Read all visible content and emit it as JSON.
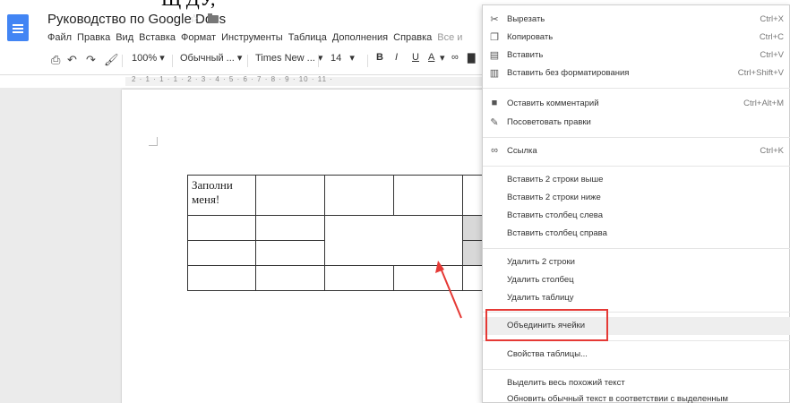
{
  "top_clip": "Щ ДУ,",
  "header": {
    "title": "Руководство по Google Docs",
    "menu": [
      "Файл",
      "Правка",
      "Вид",
      "Вставка",
      "Формат",
      "Инструменты",
      "Таблица",
      "Дополнения",
      "Справка",
      "Все и"
    ]
  },
  "toolbar": {
    "zoom": "100%",
    "style": "Обычный ...",
    "font": "Times New ...",
    "size": "14",
    "bold": "B",
    "italic": "I",
    "underline": "U",
    "textcolor": "A"
  },
  "ruler": "2 · 1 · 1 · 1 · 2 · 3 · 4 · 5 · 6 · 7 · 8 · 9 · 10 · 11 ·",
  "table": {
    "cell_text": "Заполни меня!"
  },
  "context_menu": {
    "items": [
      {
        "label": "Вырезать",
        "shortcut": "Ctrl+X",
        "icon": "scissors-icon"
      },
      {
        "label": "Копировать",
        "shortcut": "Ctrl+C",
        "icon": "copy-icon"
      },
      {
        "label": "Вставить",
        "shortcut": "Ctrl+V",
        "icon": "paste-icon"
      },
      {
        "label": "Вставить без форматирования",
        "shortcut": "Ctrl+Shift+V",
        "icon": "paste-plain-icon"
      },
      {
        "label": "Оставить комментарий",
        "shortcut": "Ctrl+Alt+M",
        "icon": "comment-icon"
      },
      {
        "label": "Посоветовать правки",
        "shortcut": "",
        "icon": "suggest-icon"
      },
      {
        "label": "Ссылка",
        "shortcut": "Ctrl+K",
        "icon": "link-icon"
      },
      {
        "label": "Вставить 2 строки выше",
        "shortcut": ""
      },
      {
        "label": "Вставить 2 строки ниже",
        "shortcut": ""
      },
      {
        "label": "Вставить столбец слева",
        "shortcut": ""
      },
      {
        "label": "Вставить столбец справа",
        "shortcut": ""
      },
      {
        "label": "Удалить 2 строки",
        "shortcut": ""
      },
      {
        "label": "Удалить столбец",
        "shortcut": ""
      },
      {
        "label": "Удалить таблицу",
        "shortcut": ""
      },
      {
        "label": "Объединить ячейки",
        "shortcut": ""
      },
      {
        "label": "Свойства таблицы...",
        "shortcut": ""
      },
      {
        "label": "Выделить весь похожий текст",
        "shortcut": ""
      },
      {
        "label": "Обновить обычный текст в соответствии с выделенным",
        "shortcut": ""
      }
    ]
  },
  "colors": {
    "accent": "#4285f4",
    "highlight_box": "#e53935",
    "arrow": "#e53935"
  }
}
